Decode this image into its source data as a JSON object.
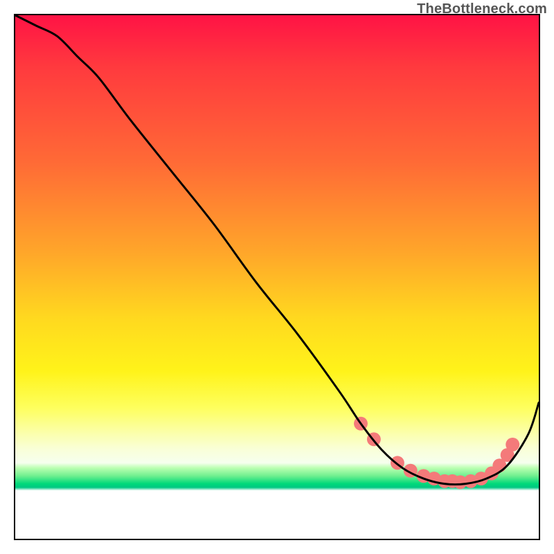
{
  "watermark": "TheBottleneck.com",
  "chart_data": {
    "type": "line",
    "title": "",
    "xlabel": "",
    "ylabel": "",
    "xlim": [
      0,
      100
    ],
    "ylim": [
      0,
      100
    ],
    "grid": false,
    "legend": false,
    "series": [
      {
        "name": "bottleneck-curve",
        "color": "#000000",
        "x": [
          0,
          4,
          8,
          12,
          16,
          22,
          30,
          38,
          46,
          54,
          62,
          66,
          70,
          74,
          78,
          82,
          86,
          90,
          94,
          98,
          100
        ],
        "y": [
          100,
          98,
          96,
          92,
          88,
          80,
          70,
          60,
          49,
          39,
          28,
          22,
          17,
          13.5,
          11.5,
          10.5,
          10.5,
          11.5,
          14,
          20,
          26
        ]
      }
    ],
    "markers": {
      "name": "highlight-dots",
      "color": "#f47a7a",
      "radius": 10,
      "points": [
        {
          "x": 66,
          "y": 22
        },
        {
          "x": 68.5,
          "y": 19
        },
        {
          "x": 73,
          "y": 14.5
        },
        {
          "x": 75.5,
          "y": 13
        },
        {
          "x": 78,
          "y": 12
        },
        {
          "x": 80,
          "y": 11.5
        },
        {
          "x": 82,
          "y": 11
        },
        {
          "x": 83.5,
          "y": 11
        },
        {
          "x": 85,
          "y": 10.8
        },
        {
          "x": 87,
          "y": 11
        },
        {
          "x": 89,
          "y": 11.5
        },
        {
          "x": 91,
          "y": 12.5
        },
        {
          "x": 92.5,
          "y": 14
        },
        {
          "x": 94,
          "y": 16
        },
        {
          "x": 95,
          "y": 18
        }
      ]
    },
    "background_gradient_stops": [
      {
        "pos": 0.0,
        "color": "#ff1345"
      },
      {
        "pos": 0.3,
        "color": "#ff7a30"
      },
      {
        "pos": 0.58,
        "color": "#ffd91f"
      },
      {
        "pos": 0.75,
        "color": "#feff5e"
      },
      {
        "pos": 0.86,
        "color": "#b9ffb0"
      },
      {
        "pos": 0.895,
        "color": "#00d97a"
      },
      {
        "pos": 0.91,
        "color": "#ffffff"
      }
    ]
  }
}
